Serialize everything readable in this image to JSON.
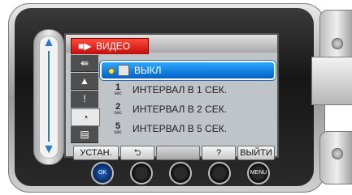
{
  "screen": {
    "tab_label": "ВИДЕО",
    "tab_icon": "camcorder-icon",
    "side_icons": [
      "interval-arrow-icon",
      "scene-icon",
      "exclamation-icon",
      "time-lapse-icon",
      "display-icon"
    ],
    "menu_items": [
      {
        "label": "ВЫКЛ",
        "selected": true,
        "icon": "off-icon"
      },
      {
        "label": "ИНТЕРВАЛ В 1 СЕК.",
        "selected": false,
        "icon_num": "1",
        "icon_sub": "sec"
      },
      {
        "label": "ИНТЕРВАЛ В 2 СЕК.",
        "selected": false,
        "icon_num": "2",
        "icon_sub": "sec"
      },
      {
        "label": "ИНТЕРВАЛ В 5 СЕК.",
        "selected": false,
        "icon_num": "5",
        "icon_sub": "sec"
      }
    ]
  },
  "softbuttons": {
    "set": "УСТАН.",
    "back": "⮌",
    "help": "?",
    "exit": "ВЫЙТИ"
  },
  "hardware": {
    "ok_label": "OK",
    "menu_label": "MENU"
  },
  "colors": {
    "tab_red": "#e01f1f",
    "selection_blue": "#1677d9",
    "slider_blue": "#2a78c8",
    "scroll_caret": "#f5a000"
  }
}
